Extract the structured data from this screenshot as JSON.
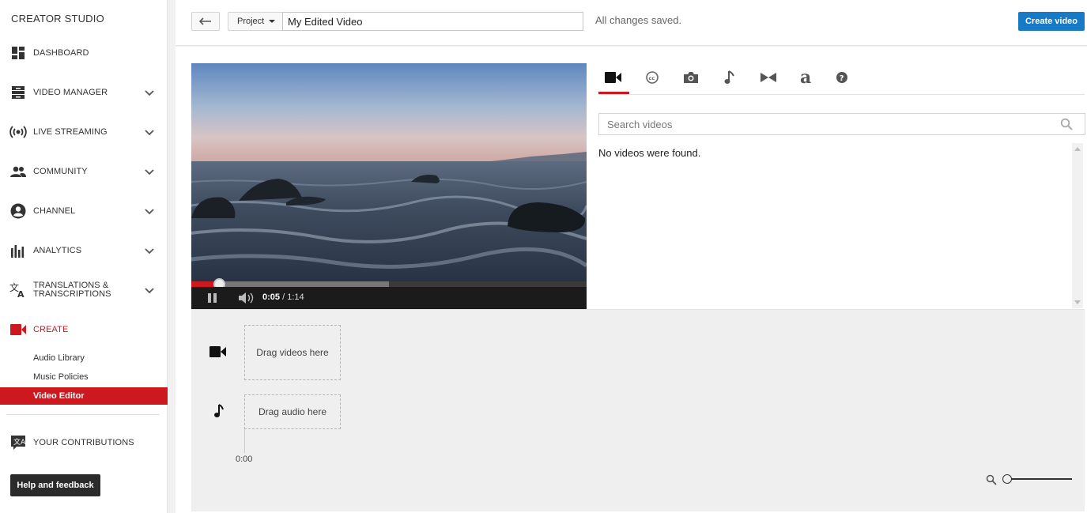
{
  "sidebar": {
    "brand": "CREATOR STUDIO",
    "items": [
      {
        "label": "DASHBOARD",
        "icon": "dashboard-icon"
      },
      {
        "label": "VIDEO MANAGER",
        "icon": "video-manager-icon"
      },
      {
        "label": "LIVE STREAMING",
        "icon": "live-streaming-icon"
      },
      {
        "label": "COMMUNITY",
        "icon": "community-icon"
      },
      {
        "label": "CHANNEL",
        "icon": "channel-icon"
      },
      {
        "label": "ANALYTICS",
        "icon": "analytics-icon"
      },
      {
        "label_line1": "TRANSLATIONS &",
        "label_line2": "TRANSCRIPTIONS",
        "icon": "translate-icon"
      },
      {
        "label": "CREATE",
        "icon": "create-camera-icon"
      }
    ],
    "create_subitems": [
      "Audio Library",
      "Music Policies",
      "Video Editor"
    ],
    "contributions": "YOUR CONTRIBUTIONS",
    "help": "Help and feedback"
  },
  "topbar": {
    "project_label": "Project",
    "title_value": "My Edited Video",
    "save_status": "All changes saved.",
    "create_label": "Create video"
  },
  "player": {
    "current_time": "0:05",
    "duration": "/ 1:14",
    "played_fraction": 0.07,
    "buffered_fraction": 0.5
  },
  "library": {
    "tabs": [
      "video-tab",
      "captions-tab",
      "photos-tab",
      "music-tab",
      "transitions-tab",
      "text-tab",
      "help-tab"
    ],
    "search_placeholder": "Search videos",
    "empty_message": "No videos were found."
  },
  "timeline": {
    "video_drop": "Drag videos here",
    "audio_drop": "Drag audio here",
    "start_time": "0:00"
  },
  "colors": {
    "accent_red": "#cc181e",
    "create_blue": "#167ac6"
  }
}
